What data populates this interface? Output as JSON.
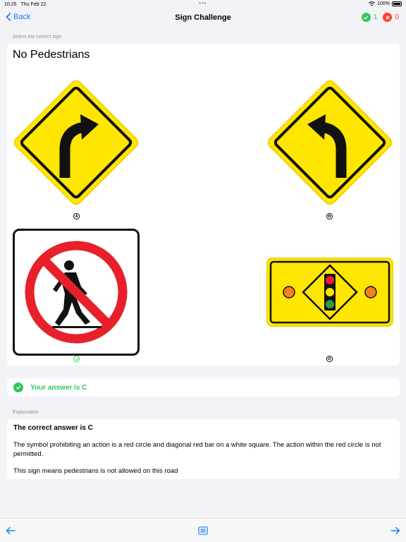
{
  "status_bar": {
    "time": "10:25",
    "date": "Thu Feb 22",
    "dots": "•••",
    "battery": "100%"
  },
  "nav": {
    "back_label": "Back",
    "title": "Sign Challenge",
    "correct_count": "1",
    "wrong_count": "0"
  },
  "question": {
    "section_label": "Select the correct sign",
    "text": "No Pedestrians",
    "options": [
      {
        "letter": "A",
        "sign": "curve-right-warning"
      },
      {
        "letter": "B",
        "sign": "curve-left-warning"
      },
      {
        "letter": "C",
        "sign": "no-pedestrians",
        "selected": true
      },
      {
        "letter": "D",
        "sign": "traffic-signal-ahead"
      }
    ]
  },
  "answer": {
    "text": "Your answer is C"
  },
  "explanation": {
    "section_label": "Explanation",
    "heading": "The correct answer is C",
    "body": "The symbol prohibiting an action is a red circle and diagonal red bar on a white square. The action within the red circle is not permitted.",
    "meaning": "This sign means pedestrians is not allowed on this road"
  },
  "colors": {
    "accent": "#1a7cf5",
    "correct": "#34c759",
    "wrong": "#ff3b30",
    "sign_yellow": "#ffe600",
    "sign_red": "#e8202a"
  }
}
